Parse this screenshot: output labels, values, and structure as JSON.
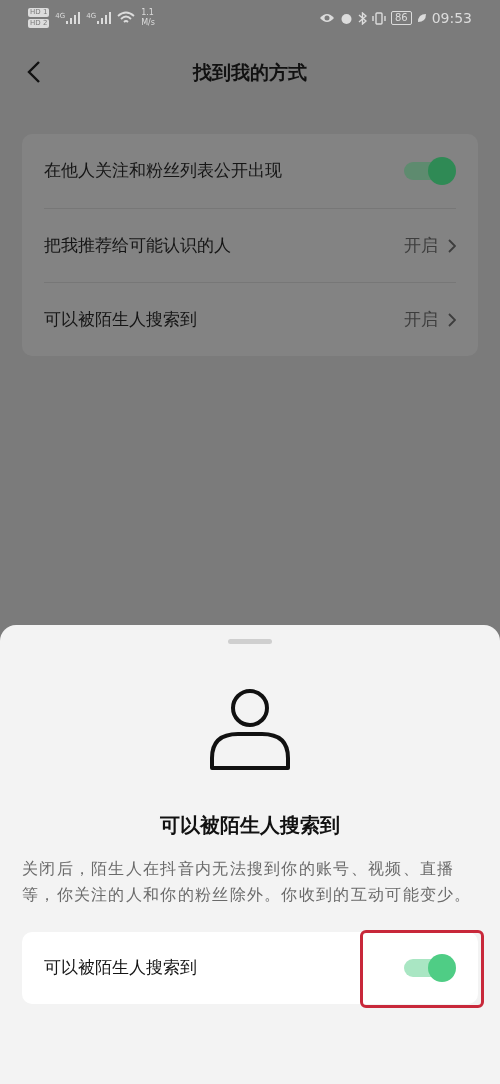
{
  "status_bar": {
    "sim_labels": [
      {
        "badge": "HD",
        "slot": "1"
      },
      {
        "badge": "HD",
        "slot": "2"
      }
    ],
    "networks": [
      "4G",
      "4G"
    ],
    "speed": [
      "1.1",
      "M/s"
    ],
    "battery": "86",
    "time": "09:53"
  },
  "header": {
    "title": "找到我的方式"
  },
  "settings": [
    {
      "kind": "toggle",
      "label": "在他人关注和粉丝列表公开出现",
      "on": true
    },
    {
      "kind": "link",
      "label": "把我推荐给可能认识的人",
      "value": "开启"
    },
    {
      "kind": "link",
      "label": "可以被陌生人搜索到",
      "value": "开启"
    }
  ],
  "sheet": {
    "title": "可以被陌生人搜索到",
    "description": "关闭后，陌生人在抖音内无法搜到你的账号、视频、直播等，你关注的人和你的粉丝除外。你收到的互动可能变少。",
    "toggle": {
      "label": "可以被陌生人搜索到",
      "on": true
    }
  }
}
